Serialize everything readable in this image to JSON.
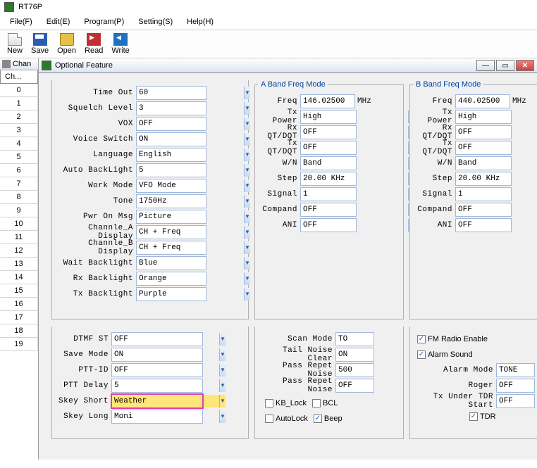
{
  "app": {
    "title": "RT76P"
  },
  "menu": [
    "File(F)",
    "Edit(E)",
    "Program(P)",
    "Setting(S)",
    "Help(H)"
  ],
  "toolbar": [
    "New",
    "Save",
    "Open",
    "Read",
    "Write"
  ],
  "left": {
    "tab": "Ch...",
    "title": "Chan",
    "rows": [
      "0",
      "1",
      "2",
      "3",
      "4",
      "5",
      "6",
      "7",
      "8",
      "9",
      "10",
      "11",
      "12",
      "13",
      "14",
      "15",
      "16",
      "17",
      "18",
      "19"
    ]
  },
  "dialog": {
    "title": "Optional Feature"
  },
  "general": {
    "items": [
      {
        "label": "Time Out",
        "value": "60"
      },
      {
        "label": "Squelch Level",
        "value": "3"
      },
      {
        "label": "VOX",
        "value": "OFF"
      },
      {
        "label": "Voice Switch",
        "value": "ON"
      },
      {
        "label": "Language",
        "value": "English"
      },
      {
        "label": "Auto BackLight",
        "value": "5"
      },
      {
        "label": "Work Mode",
        "value": "VFO Mode"
      },
      {
        "label": "Tone",
        "value": "1750Hz"
      },
      {
        "label": "Pwr On Msg",
        "value": "Picture"
      },
      {
        "label": "Channle_A Display",
        "value": "CH + Freq"
      },
      {
        "label": "Channle_B Display",
        "value": "CH + Freq"
      },
      {
        "label": "Wait Backlight",
        "value": "Blue"
      },
      {
        "label": "Rx Backlight",
        "value": "Orange"
      },
      {
        "label": "Tx Backlight",
        "value": "Purple"
      }
    ]
  },
  "bandA": {
    "legend": "A Band Freq Mode",
    "freq_label": "Freq",
    "freq": "146.02500",
    "unit": "MHz",
    "items": [
      {
        "label": "Tx Power",
        "value": "High"
      },
      {
        "label": "Rx QT/DQT",
        "value": "OFF"
      },
      {
        "label": "Tx QT/DQT",
        "value": "OFF"
      },
      {
        "label": "W/N",
        "value": "Band"
      },
      {
        "label": "Step",
        "value": "20.00 KHz"
      },
      {
        "label": "Signal",
        "value": "1"
      },
      {
        "label": "Compand",
        "value": "OFF"
      },
      {
        "label": "ANI",
        "value": "OFF"
      }
    ]
  },
  "bandB": {
    "legend": "B Band Freq Mode",
    "freq_label": "Freq",
    "freq": "440.02500",
    "unit": "MHz",
    "items": [
      {
        "label": "Tx Power",
        "value": "High"
      },
      {
        "label": "Rx QT/DQT",
        "value": "OFF"
      },
      {
        "label": "Tx QT/DQT",
        "value": "OFF"
      },
      {
        "label": "W/N",
        "value": "Band"
      },
      {
        "label": "Step",
        "value": "20.00 KHz"
      },
      {
        "label": "Signal",
        "value": "1"
      },
      {
        "label": "Compand",
        "value": "OFF"
      },
      {
        "label": "ANI",
        "value": "OFF"
      }
    ]
  },
  "bottomLeft": {
    "items": [
      {
        "label": "DTMF ST",
        "value": "OFF"
      },
      {
        "label": "Save Mode",
        "value": "ON"
      },
      {
        "label": "PTT-ID",
        "value": "OFF"
      },
      {
        "label": "PTT Delay",
        "value": "5"
      },
      {
        "label": "Skey Short",
        "value": "Weather",
        "hl": true
      },
      {
        "label": "Skey Long",
        "value": "Moni"
      }
    ]
  },
  "bottomMid": {
    "items": [
      {
        "label": "Scan Mode",
        "value": "TO"
      },
      {
        "label": "Tail Noise Clear",
        "value": "ON"
      },
      {
        "label": "Pass Repet Noise",
        "value": "500"
      },
      {
        "label": "Pass Repet Noise",
        "value": "OFF"
      }
    ],
    "checks": [
      {
        "label": "KB_Lock",
        "checked": false
      },
      {
        "label": "BCL",
        "checked": false
      },
      {
        "label": "AutoLock",
        "checked": false
      },
      {
        "label": "Beep",
        "checked": true
      }
    ]
  },
  "bottomRight": {
    "topchecks": [
      {
        "label": "FM Radio Enable",
        "checked": true
      },
      {
        "label": "Alarm Sound",
        "checked": true
      }
    ],
    "items": [
      {
        "label": "Alarm Mode",
        "value": "TONE"
      },
      {
        "label": "Roger",
        "value": "OFF"
      },
      {
        "label": "Tx Under TDR Start",
        "value": "OFF"
      }
    ],
    "tdr": {
      "label": "TDR",
      "checked": true
    }
  }
}
